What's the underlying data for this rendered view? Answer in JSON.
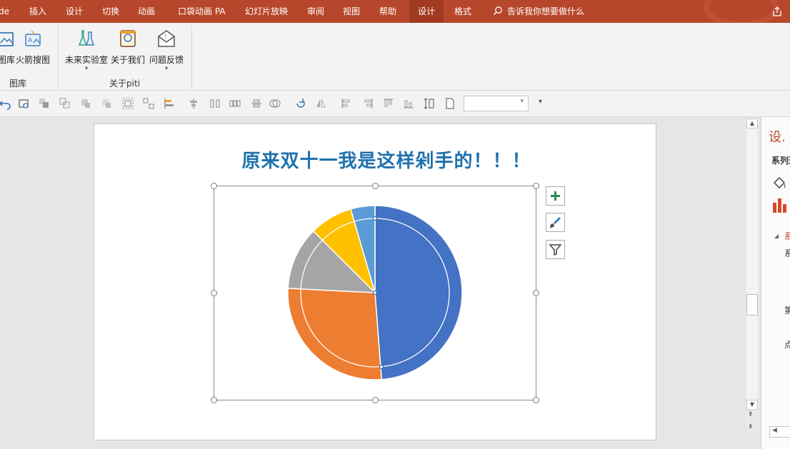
{
  "tabs": [
    {
      "label": "de",
      "active": false
    },
    {
      "label": "插入",
      "active": false
    },
    {
      "label": "设计",
      "active": false
    },
    {
      "label": "切换",
      "active": false
    },
    {
      "label": "动画",
      "active": false
    },
    {
      "label": "口袋动画 PA",
      "active": false
    },
    {
      "label": "幻灯片放映",
      "active": false
    },
    {
      "label": "审阅",
      "active": false
    },
    {
      "label": "视图",
      "active": false
    },
    {
      "label": "帮助",
      "active": false
    },
    {
      "label": "设计",
      "active": true
    },
    {
      "label": "格式",
      "active": false
    }
  ],
  "search": {
    "placeholder": "告诉我你想要做什么"
  },
  "ribbon": {
    "groups": [
      {
        "label": "图库",
        "buttons": [
          "图库",
          "火箭搜图"
        ]
      },
      {
        "label": "关于piti",
        "buttons": [
          "未来实验室",
          "关于我们",
          "问题反馈"
        ]
      }
    ]
  },
  "slide": {
    "title": "原来双十一我是这样剁手的！！！"
  },
  "pane": {
    "title": "设.",
    "labels": [
      "系列选",
      "系",
      "系",
      "第",
      "点"
    ]
  },
  "colors": {
    "tab_bar": "#b7472a",
    "title": "#1f72ad",
    "pie_blue": "#4472c4",
    "pie_orange": "#ed7d31",
    "pie_gray": "#a5a5a5",
    "pie_yellow": "#ffc000",
    "pie_lightblue": "#5b9bd5"
  },
  "chart_data": {
    "type": "pie",
    "slices": [
      {
        "value": 48.8,
        "color": "#4472c4"
      },
      {
        "value": 27.0,
        "color": "#ed7d31"
      },
      {
        "value": 11.7,
        "color": "#a5a5a5"
      },
      {
        "value": 8.0,
        "color": "#ffc000"
      },
      {
        "value": 4.5,
        "color": "#5b9bd5"
      }
    ],
    "title": "",
    "legend": "none"
  }
}
